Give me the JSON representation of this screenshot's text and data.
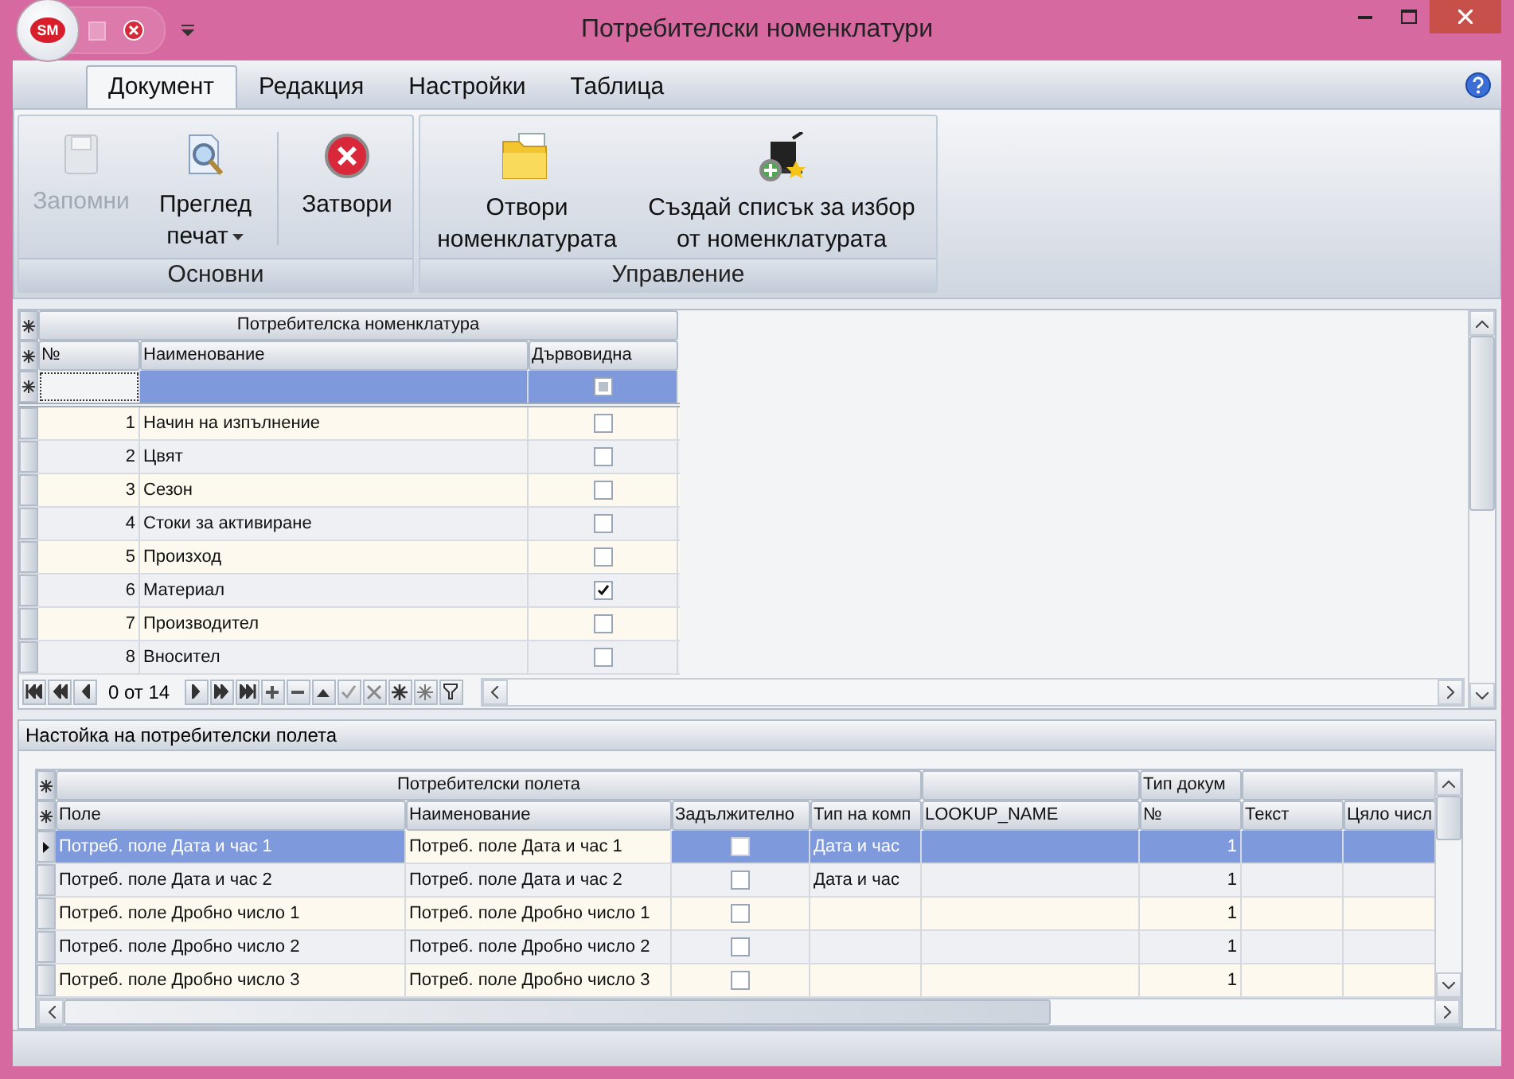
{
  "window": {
    "title": "Потребителски номенклатури",
    "app_badge": "SM"
  },
  "ribbon": {
    "tabs": [
      {
        "label": "Документ",
        "selected": true
      },
      {
        "label": "Редакция",
        "selected": false
      },
      {
        "label": "Настройки",
        "selected": false
      },
      {
        "label": "Таблица",
        "selected": false
      }
    ],
    "groups": [
      {
        "label": "Основни",
        "buttons": [
          {
            "label": "Запомни",
            "disabled": true
          },
          {
            "label": "Преглед печат",
            "dropdown": true,
            "disabled": false
          },
          {
            "label": "Затвори",
            "disabled": false,
            "separator_before": true
          }
        ]
      },
      {
        "label": "Управление",
        "buttons": [
          {
            "label": "Отвори номенклатурата",
            "disabled": false
          },
          {
            "label": "Създай списък за избор от номенклатурата",
            "disabled": false
          }
        ]
      }
    ]
  },
  "nomenclature_grid": {
    "band": "Потребителска номенклатура",
    "columns": [
      "№",
      "Наименование",
      "Дървовидна"
    ],
    "new_row": {
      "indeterminate": true
    },
    "rows": [
      {
        "number": "1",
        "name": "Начин на изпълнение",
        "checked": false
      },
      {
        "number": "2",
        "name": "Цвят",
        "checked": false
      },
      {
        "number": "3",
        "name": "Сезон",
        "checked": false
      },
      {
        "number": "4",
        "name": "Стоки за активиране",
        "checked": false
      },
      {
        "number": "5",
        "name": "Произход",
        "checked": false
      },
      {
        "number": "6",
        "name": "Материал",
        "checked": true
      },
      {
        "number": "7",
        "name": "Производител",
        "checked": false
      },
      {
        "number": "8",
        "name": "Вносител",
        "checked": false
      }
    ],
    "navigator": {
      "position": "0 от 14"
    }
  },
  "fields_panel": {
    "title": "Настойка на потребителски полета",
    "bands": [
      "Потребителски полета",
      "Тип докум"
    ],
    "columns": [
      "Поле",
      "Наименование",
      "Задължително",
      "Тип на комп",
      "LOOKUP_NAME",
      "№",
      "Текст",
      "Цяло числ"
    ],
    "rows": [
      {
        "field": "Потреб. поле Дата и час 1",
        "name": "Потреб. поле Дата и час 1",
        "required": false,
        "type": "Дата и час",
        "number": "1",
        "selected": true
      },
      {
        "field": "Потреб. поле Дата и час 2",
        "name": "Потреб. поле Дата и час 2",
        "required": false,
        "type": "Дата и час",
        "number": "1",
        "selected": false
      },
      {
        "field": "Потреб. поле Дробно число 1",
        "name": "Потреб. поле Дробно число 1",
        "required": false,
        "number": "1",
        "selected": false
      },
      {
        "field": "Потреб. поле Дробно число 2",
        "name": "Потреб. поле Дробно число 2",
        "required": false,
        "number": "1",
        "selected": false
      },
      {
        "field": "Потреб. поле Дробно число 3",
        "name": "Потреб. поле Дробно число 3",
        "required": false,
        "number": "1",
        "selected": false
      }
    ]
  }
}
